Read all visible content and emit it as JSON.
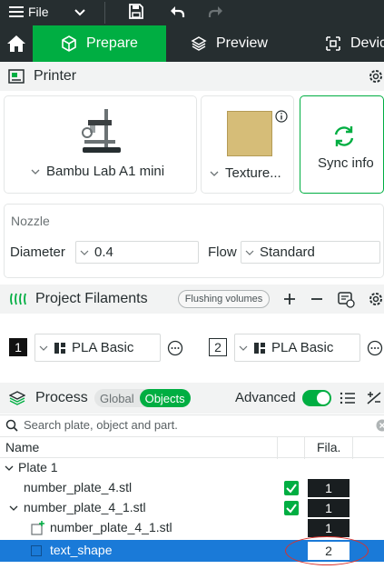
{
  "titlebar": {
    "file_label": "File"
  },
  "tabs": [
    {
      "label": "Prepare"
    },
    {
      "label": "Preview"
    },
    {
      "label": "Devic"
    }
  ],
  "printer": {
    "title": "Printer",
    "printer_name": "Bambu Lab A1 mini",
    "plate_name": "Texture...",
    "sync_label": "Sync info"
  },
  "nozzle": {
    "title": "Nozzle",
    "diameter_label": "Diameter",
    "diameter_value": "0.4",
    "flow_label": "Flow",
    "flow_value": "Standard"
  },
  "filaments": {
    "title": "Project Filaments",
    "flushing_label": "Flushing volumes",
    "items": [
      {
        "index": "1",
        "name": "PLA Basic"
      },
      {
        "index": "2",
        "name": "PLA Basic"
      }
    ]
  },
  "process": {
    "title": "Process",
    "global_label": "Global",
    "objects_label": "Objects",
    "advanced_label": "Advanced",
    "advanced_on": true
  },
  "search": {
    "placeholder": "Search plate, object and part."
  },
  "object_list": {
    "col_name": "Name",
    "col_fila": "Fila.",
    "rows": [
      {
        "name": "Plate 1",
        "fila": ""
      },
      {
        "name": "number_plate_4.stl",
        "fila": "1"
      },
      {
        "name": "number_plate_4_1.stl",
        "fila": "1"
      },
      {
        "name": "number_plate_4_1.stl",
        "fila": "1"
      },
      {
        "name": "text_shape",
        "fila": "2"
      }
    ]
  },
  "colors": {
    "accent": "#00ae42",
    "dark": "#262e30",
    "selected": "#1a7ad8",
    "annotation": "#d9322c"
  }
}
